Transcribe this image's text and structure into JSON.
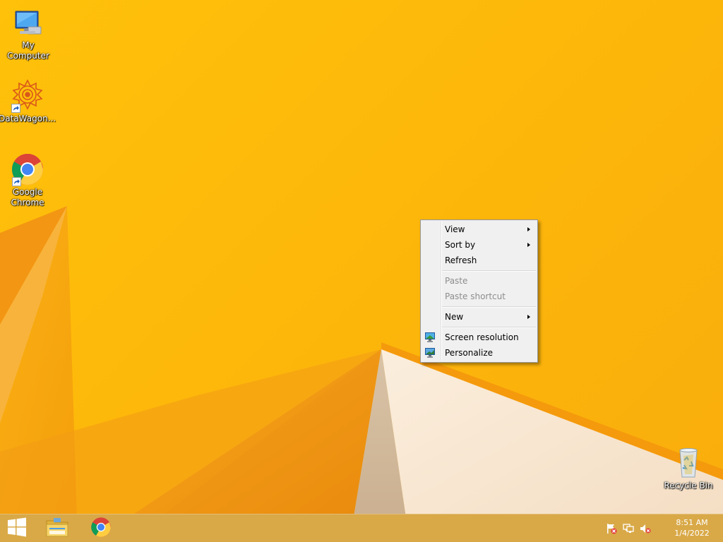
{
  "desktop": {
    "icons": [
      {
        "label": "My Computer",
        "icon": "computer-icon"
      },
      {
        "label": "DataWagon...",
        "icon": "datawagon-icon"
      },
      {
        "label": "Google\nChrome",
        "icon": "chrome-icon"
      },
      {
        "label": "Recycle Bin",
        "icon": "recycle-bin-icon"
      }
    ]
  },
  "context_menu": {
    "items": [
      {
        "label": "View",
        "submenu": true,
        "enabled": true
      },
      {
        "label": "Sort by",
        "submenu": true,
        "enabled": true
      },
      {
        "label": "Refresh",
        "submenu": false,
        "enabled": true
      },
      {
        "label": "Paste",
        "submenu": false,
        "enabled": false
      },
      {
        "label": "Paste shortcut",
        "submenu": false,
        "enabled": false
      },
      {
        "label": "New",
        "submenu": true,
        "enabled": true
      },
      {
        "label": "Screen resolution",
        "submenu": false,
        "enabled": true,
        "icon": "monitor-icon"
      },
      {
        "label": "Personalize",
        "submenu": false,
        "enabled": true,
        "icon": "personalize-icon"
      }
    ]
  },
  "taskbar": {
    "start_icon": "windows-logo-icon",
    "pinned": [
      {
        "name": "File Explorer",
        "icon": "folder-icon"
      },
      {
        "name": "Google Chrome",
        "icon": "chrome-icon"
      }
    ],
    "tray": {
      "icons": [
        "action-center-flag-icon",
        "network-icon",
        "volume-muted-icon"
      ],
      "time": "8:51 AM",
      "date": "1/4/2022"
    }
  },
  "colors": {
    "wallpaper_primary": "#fdb80a",
    "wallpaper_dark": "#f08c0c",
    "wallpaper_light": "#fbe8cf",
    "taskbar": "#d9a948",
    "menu_bg": "#f0f0f0",
    "menu_border": "#979797"
  }
}
